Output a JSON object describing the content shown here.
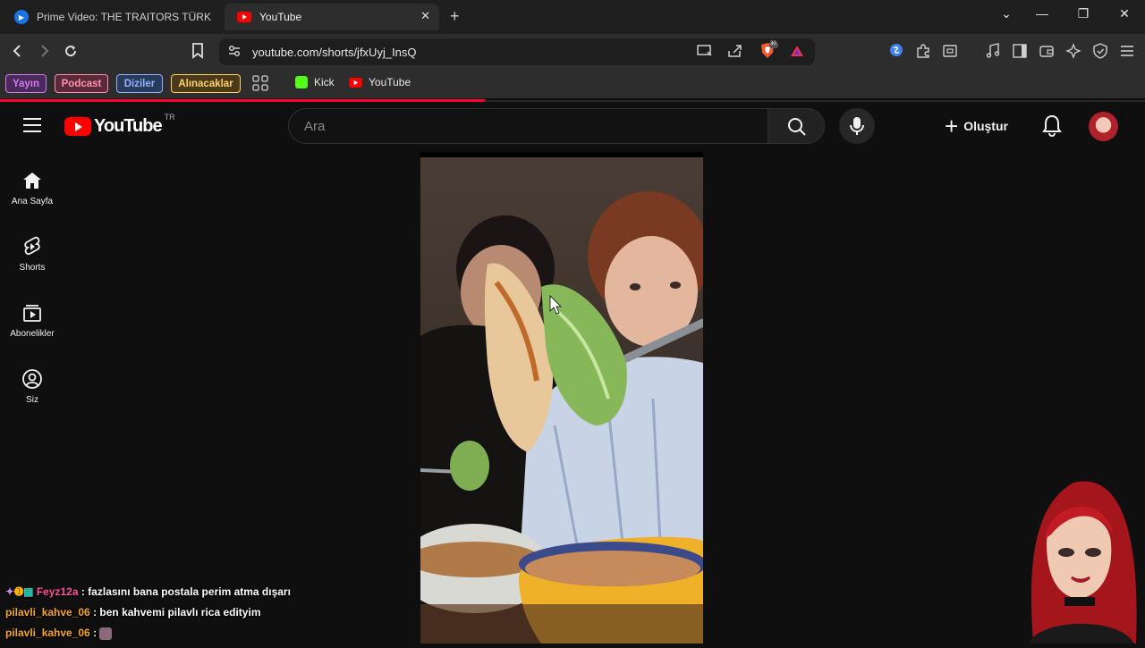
{
  "browser": {
    "tabs": [
      {
        "title": "Prime Video: THE TRAITORS TÜRKİYE",
        "active": false
      },
      {
        "title": "YouTube",
        "active": true
      }
    ],
    "url": "youtube.com/shorts/jfxUyj_InsQ",
    "brave_shield_count": "30",
    "bookmarks": [
      {
        "label": "Yayın",
        "color": "#d07cf0",
        "bg": "#4a2a5a"
      },
      {
        "label": "Podcast",
        "color": "#ff8fb0",
        "bg": "#5a2a3a"
      },
      {
        "label": "Diziler",
        "color": "#8fb4ff",
        "bg": "#2a3a5a"
      },
      {
        "label": "Alınacaklar",
        "color": "#ffd166",
        "bg": "#4a3a1a"
      }
    ],
    "bookmark_links": [
      {
        "label": "Kick",
        "icon": "kick-icon"
      },
      {
        "label": "YouTube",
        "icon": "youtube-icon"
      }
    ]
  },
  "youtube": {
    "logo_text": "YouTube",
    "country_code": "TR",
    "search_placeholder": "Ara",
    "create_label": "Oluştur",
    "sidebar": [
      {
        "label": "Ana Sayfa",
        "icon": "home-icon"
      },
      {
        "label": "Shorts",
        "icon": "shorts-icon"
      },
      {
        "label": "Abonelikler",
        "icon": "subscriptions-icon"
      },
      {
        "label": "Siz",
        "icon": "you-icon"
      }
    ]
  },
  "chat": [
    {
      "user": "Feyz12a",
      "message": ": fazlasını bana postala perim atma dışarı"
    },
    {
      "user": "pilavli_kahve_06",
      "message": ": ben kahvemi pilavlı rica edityim"
    },
    {
      "user": "pilavli_kahve_06",
      "message": ":"
    }
  ],
  "colors": {
    "accent_red": "#ff0000",
    "progress": "#ff0033"
  }
}
